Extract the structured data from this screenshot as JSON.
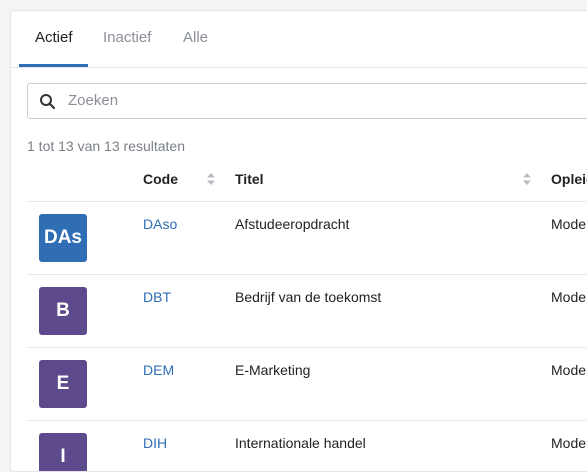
{
  "tabs": [
    {
      "label": "Actief",
      "active": true
    },
    {
      "label": "Inactief",
      "active": false
    },
    {
      "label": "Alle",
      "active": false
    }
  ],
  "search": {
    "placeholder": "Zoeken",
    "value": ""
  },
  "results_text": "1 tot 13 van 13 resultaten",
  "table": {
    "headers": {
      "code": "Code",
      "title": "Titel",
      "opleiding": "Opleid"
    },
    "rows": [
      {
        "avatar": "DAs",
        "avatar_color": "#2f6db5",
        "code": "DAso",
        "title": "Afstudeeropdracht",
        "opleiding": "Mode"
      },
      {
        "avatar": "B",
        "avatar_color": "#5d4a8c",
        "code": "DBT",
        "title": "Bedrijf van de toekomst",
        "opleiding": "Mode"
      },
      {
        "avatar": "E",
        "avatar_color": "#5d4a8c",
        "code": "DEM",
        "title": "E-Marketing",
        "opleiding": "Mode"
      },
      {
        "avatar": "I",
        "avatar_color": "#5d4a8c",
        "code": "DIH",
        "title": "Internationale handel",
        "opleiding": "Mode"
      }
    ]
  },
  "colors": {
    "accent": "#2f6db5",
    "avatar_purple": "#5d4a8c"
  }
}
